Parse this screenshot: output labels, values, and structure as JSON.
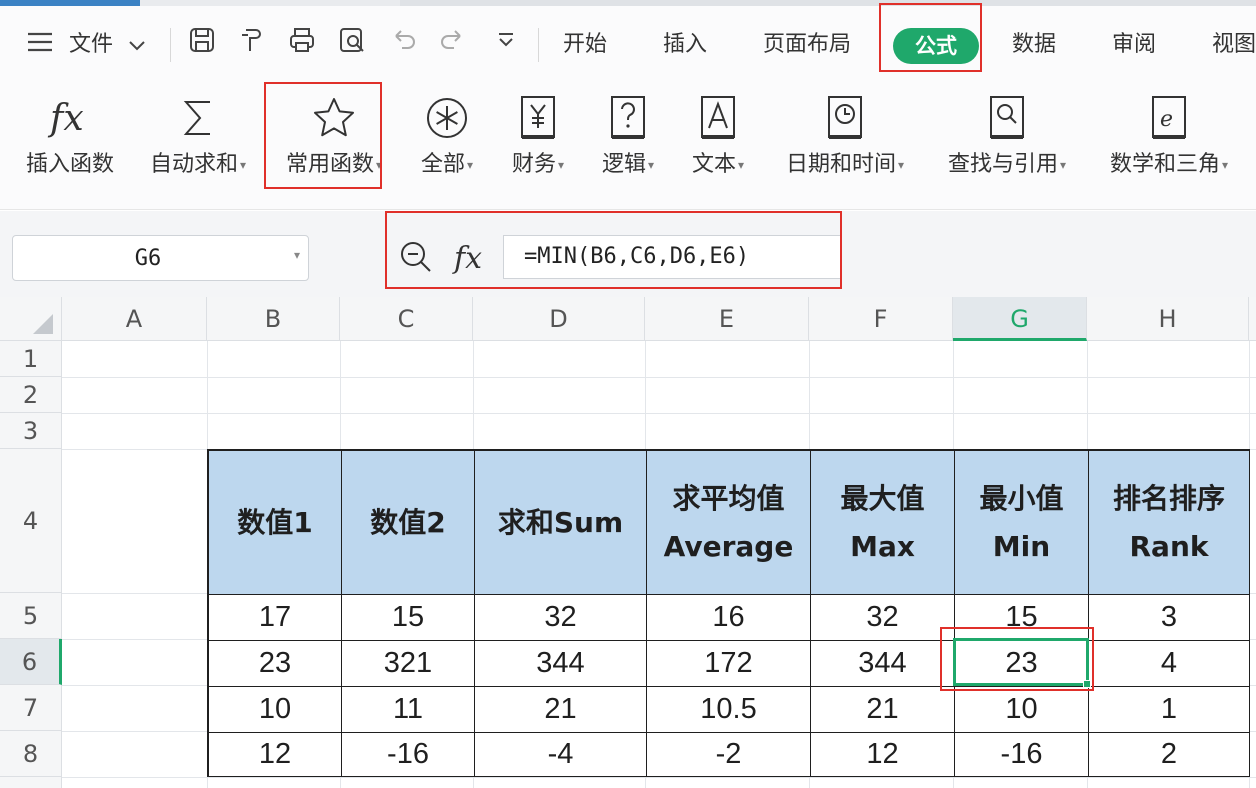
{
  "menu": {
    "file_label": "文件",
    "tabs": [
      "开始",
      "插入",
      "页面布局",
      "公式",
      "数据",
      "审阅",
      "视图"
    ],
    "active_tab": "公式"
  },
  "ribbon": {
    "buttons": [
      {
        "label": "插入函数",
        "icon": "fx-icon"
      },
      {
        "label": "自动求和",
        "icon": "sigma-icon"
      },
      {
        "label": "常用函数",
        "icon": "star-icon"
      },
      {
        "label": "全部",
        "icon": "asterisk-icon"
      },
      {
        "label": "财务",
        "icon": "yen-book-icon"
      },
      {
        "label": "逻辑",
        "icon": "question-book-icon"
      },
      {
        "label": "文本",
        "icon": "text-book-icon"
      },
      {
        "label": "日期和时间",
        "icon": "clock-book-icon"
      },
      {
        "label": "查找与引用",
        "icon": "search-book-icon"
      },
      {
        "label": "数学和三角",
        "icon": "math-book-icon"
      }
    ]
  },
  "formula_bar": {
    "name_box": "G6",
    "formula": "=MIN(B6,C6,D6,E6)"
  },
  "sheet": {
    "columns": [
      "A",
      "B",
      "C",
      "D",
      "E",
      "F",
      "G",
      "H"
    ],
    "selected_column": "G",
    "rows": [
      "1",
      "2",
      "3",
      "4",
      "5",
      "6",
      "7",
      "8"
    ],
    "selected_row": "6",
    "table_headers": [
      [
        "数值1"
      ],
      [
        "数值2"
      ],
      [
        "求和Sum"
      ],
      [
        "求平均值",
        "Average"
      ],
      [
        "最大值",
        "Max"
      ],
      [
        "最小值",
        "Min"
      ],
      [
        "排名排序",
        "Rank"
      ]
    ],
    "table_rows": [
      [
        "17",
        "15",
        "32",
        "16",
        "32",
        "15",
        "3"
      ],
      [
        "23",
        "321",
        "344",
        "172",
        "344",
        "23",
        "4"
      ],
      [
        "10",
        "11",
        "21",
        "10.5",
        "21",
        "10",
        "1"
      ],
      [
        "12",
        "-16",
        "-4",
        "-2",
        "12",
        "-16",
        "2"
      ]
    ]
  },
  "colors": {
    "accent": "#1fa86b",
    "header_fill": "#bdd7ee",
    "highlight_box": "#e0302a"
  }
}
